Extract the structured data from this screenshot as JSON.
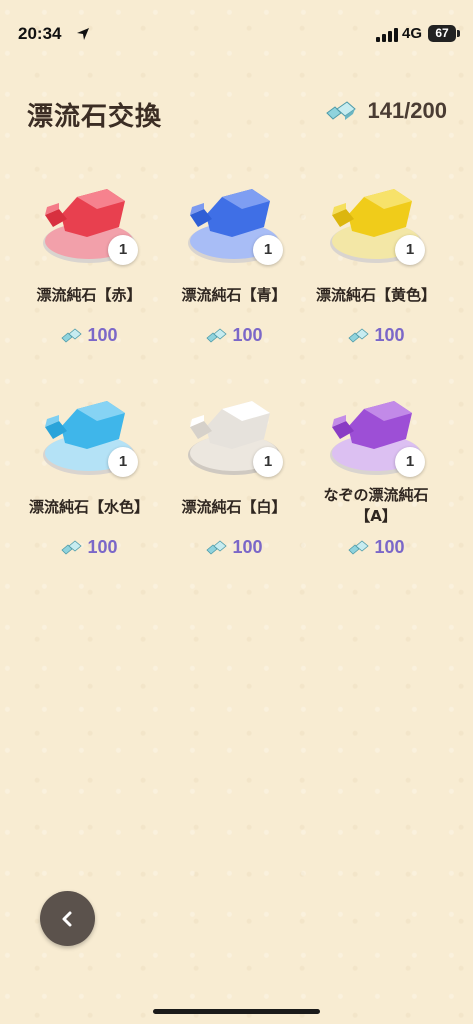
{
  "status": {
    "time": "20:34",
    "network": "4G",
    "battery": "67"
  },
  "header": {
    "title": "漂流石交換",
    "stock": "141/200",
    "stock_icon": "crystal-icon"
  },
  "colors": {
    "cost": "#7b67c8",
    "background": "#f8ecd2"
  },
  "items": [
    {
      "name": "漂流純石【赤】",
      "quantity": "1",
      "cost": "100",
      "color": "#e8404f",
      "light": "#f7a3ad"
    },
    {
      "name": "漂流純石【青】",
      "quantity": "1",
      "cost": "100",
      "color": "#3f6fe6",
      "light": "#9bb6f6"
    },
    {
      "name": "漂流純石【黄色】",
      "quantity": "1",
      "cost": "100",
      "color": "#f0cc1a",
      "light": "#faea8c"
    },
    {
      "name": "漂流純石【水色】",
      "quantity": "1",
      "cost": "100",
      "color": "#3fb6ea",
      "light": "#a6dff7"
    },
    {
      "name": "漂流純石【白】",
      "quantity": "1",
      "cost": "100",
      "color": "#e6e2dc",
      "light": "#ffffff"
    },
    {
      "name": "なぞの漂流純石【A】",
      "quantity": "1",
      "cost": "100",
      "color": "#9d4fd6",
      "light": "#d2a9f0"
    }
  ],
  "back_button": {
    "icon": "chevron-left-icon"
  }
}
